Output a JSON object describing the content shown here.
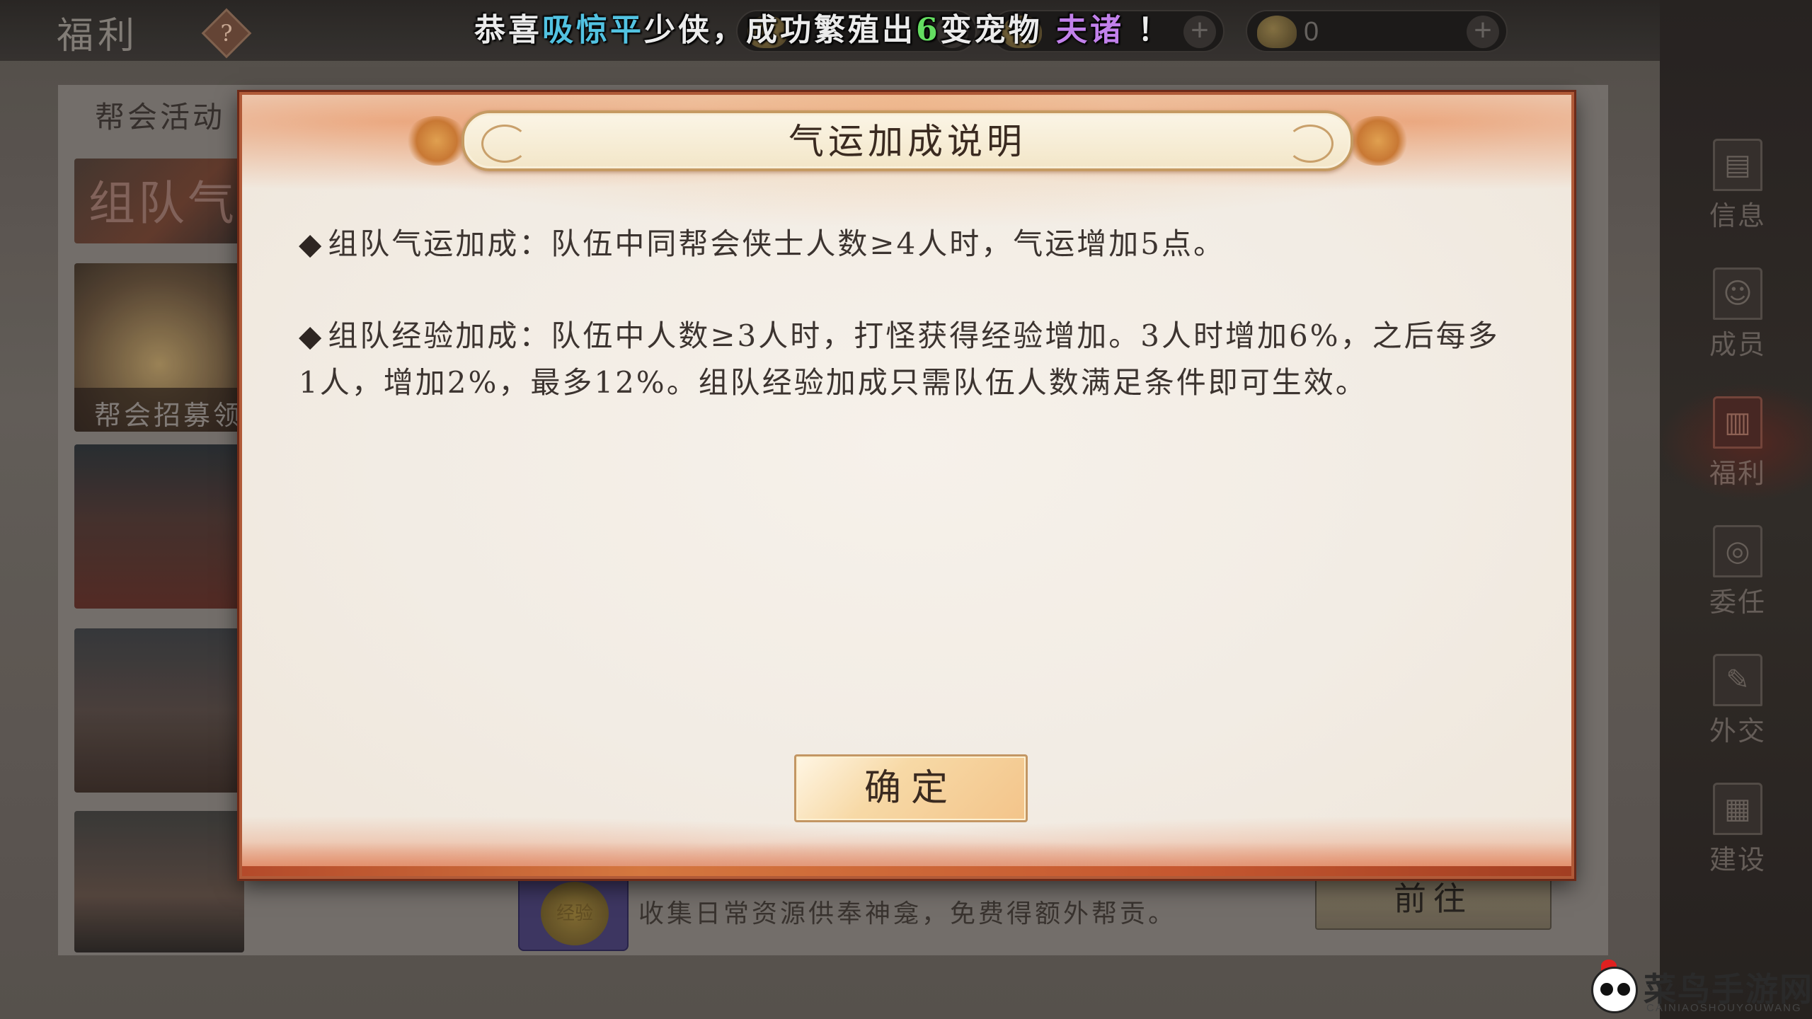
{
  "top_bar": {
    "title": "福利",
    "help_icon": "question-icon",
    "resources": [
      {
        "icon": "coin-icon",
        "amount": ""
      },
      {
        "icon": "gold-ingot-icon",
        "amount": "0"
      }
    ]
  },
  "announcement": {
    "prefix": "恭喜",
    "player_name": "吸惊平",
    "mid1": "少侠，成功繁殖出",
    "number": "6",
    "mid2": "变宠物 ",
    "pet_name": "夫诸",
    "suffix": " ！",
    "colors": {
      "player": "#5ad3f5",
      "number": "#6df06a",
      "pet": "#d38cff"
    }
  },
  "left_panel": {
    "tab_label": "帮会活动",
    "cards": [
      {
        "title": "组队气运"
      },
      {
        "caption": "帮会招募领"
      },
      {},
      {},
      {}
    ]
  },
  "activity_row": {
    "icon_text": "经验",
    "description": "收集日常资源供奉神龛，免费得额外帮贡。",
    "button_label": "前往"
  },
  "right_nav": {
    "items": [
      {
        "label": "信息",
        "icon": "info-icon"
      },
      {
        "label": "成员",
        "icon": "members-icon"
      },
      {
        "label": "福利",
        "icon": "welfare-icon",
        "active": true
      },
      {
        "label": "委任",
        "icon": "appoint-icon"
      },
      {
        "label": "外交",
        "icon": "diplomacy-icon"
      },
      {
        "label": "建设",
        "icon": "build-icon"
      }
    ]
  },
  "modal": {
    "title": "气运加成说明",
    "rules": [
      {
        "bullet": "◆",
        "text": "组队气运加成：队伍中同帮会侠士人数≥4人时，气运增加5点。"
      },
      {
        "bullet": "◆",
        "text": "组队经验加成：队伍中人数≥3人时，打怪获得经验增加。3人时增加6%，之后每多1人，增加2%，最多12%。组队经验加成只需队伍人数满足条件即可生效。"
      }
    ],
    "confirm_label": "确定"
  },
  "watermark": {
    "text": "菜鸟手游网",
    "sub": "CAINIAOSHOUYOUWANG"
  }
}
